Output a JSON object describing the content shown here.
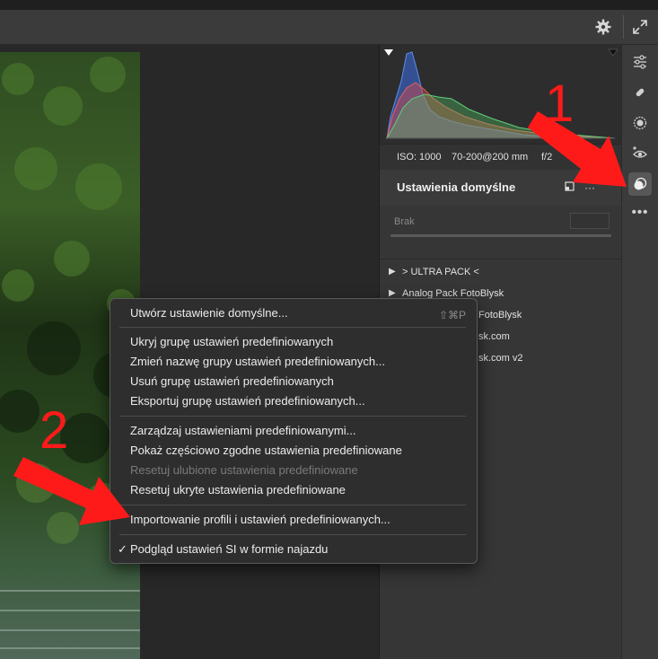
{
  "toolbar": {
    "settings_icon": "gear-icon",
    "expand_icon": "expand-icon"
  },
  "histogram": {
    "shadow_clip_icon": "shadow-clipping-icon",
    "highlight_clip_icon": "highlight-clipping-icon"
  },
  "meta": {
    "iso": "ISO: 1000",
    "lens": "70-200@200 mm",
    "aperture": "f/2"
  },
  "presets": {
    "title": "Ustawienia domyślne",
    "amount_label": "Brak",
    "groups": [
      "> ULTRA PACK <",
      "Analog Pack FotoBlysk",
      "FotoBlysk",
      "sk.com",
      "sk.com v2"
    ]
  },
  "right_toolbar": [
    "edit-sliders-icon",
    "healing-bandage-icon",
    "masking-icon",
    "red-eye-icon",
    "presets-icon",
    "more-icon"
  ],
  "menu": {
    "create_preset": "Utwórz ustawienie domyślne...",
    "create_shortcut": "⇧⌘P",
    "hide_group": "Ukryj grupę ustawień predefiniowanych",
    "rename_group": "Zmień nazwę grupy ustawień predefiniowanych...",
    "delete_group": "Usuń grupę ustawień predefiniowanych",
    "export_group": "Eksportuj grupę ustawień predefiniowanych...",
    "manage_presets": "Zarządzaj ustawieniami predefiniowanymi...",
    "show_partial": "Pokaż częściowo zgodne ustawienia predefiniowane",
    "reset_favorites": "Resetuj ulubione ustawienia predefiniowane",
    "reset_hidden": "Resetuj ukryte ustawienia predefiniowane",
    "import_profiles": "Importowanie profili i ustawień predefiniowanych...",
    "hover_preview": "Podgląd ustawień SI w formie najazdu",
    "hover_preview_check": "✓"
  },
  "annotations": {
    "step1": "1",
    "step2": "2",
    "color": "#ff1a1a"
  }
}
